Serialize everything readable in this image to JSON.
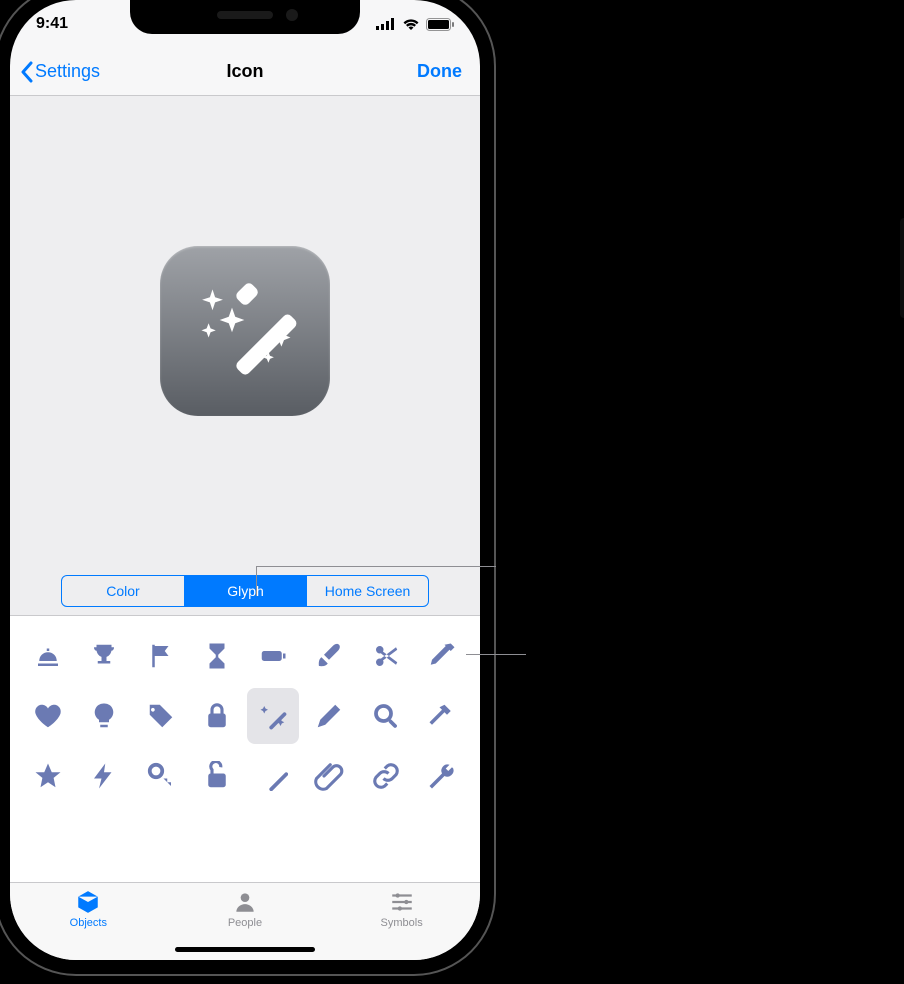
{
  "status": {
    "time": "9:41"
  },
  "nav": {
    "back": "Settings",
    "title": "Icon",
    "done": "Done"
  },
  "segments": {
    "color": "Color",
    "glyph": "Glyph",
    "home": "Home Screen"
  },
  "preview": {
    "glyph": "wand-sparkles"
  },
  "glyphs": [
    [
      "bell-service",
      "trophy",
      "flag",
      "hourglass",
      "battery",
      "paintbrush",
      "scissors",
      "eyedropper"
    ],
    [
      "heart",
      "lightbulb",
      "tag",
      "lock",
      "wand-sparkles",
      "pencil",
      "magnifier",
      "hammer"
    ],
    [
      "star",
      "bolt",
      "key",
      "lock-open",
      "wand",
      "paperclip",
      "link",
      "wrench"
    ]
  ],
  "selected_glyph": "wand-sparkles",
  "tabs": {
    "objects": "Objects",
    "people": "People",
    "symbols": "Symbols"
  }
}
